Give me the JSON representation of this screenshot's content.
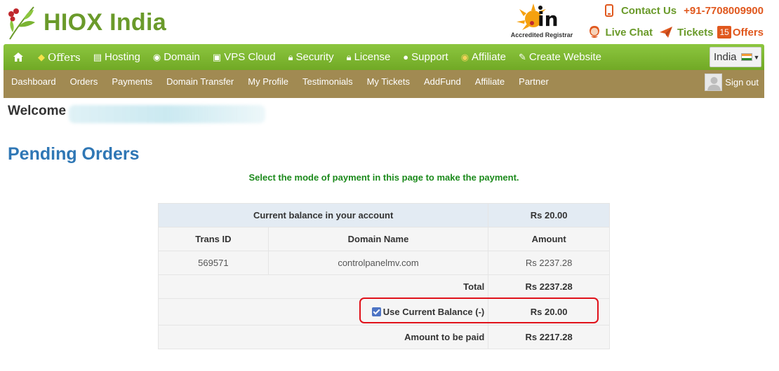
{
  "brand": {
    "name": "HIOX India"
  },
  "registrar": {
    "mark": ".in",
    "label": "Accredited Registrar"
  },
  "contact": {
    "label": "Contact Us",
    "phone": "+91-7708009900"
  },
  "support": {
    "live_chat": "Live Chat",
    "tickets": "Tickets",
    "offers_count": "15",
    "offers": "Offers"
  },
  "main_nav": {
    "items": [
      {
        "label": "Offers",
        "icon": "tag-icon"
      },
      {
        "label": "Hosting",
        "icon": "server-icon"
      },
      {
        "label": "Domain",
        "icon": "globe-icon"
      },
      {
        "label": "VPS Cloud",
        "icon": "monitor-icon"
      },
      {
        "label": "Security",
        "icon": "lock-icon"
      },
      {
        "label": "License",
        "icon": "lock-icon"
      },
      {
        "label": "Support",
        "icon": "user-icon"
      },
      {
        "label": "Affiliate",
        "icon": "money-bag-icon"
      },
      {
        "label": "Create Website",
        "icon": "pencil-icon"
      }
    ],
    "country": "India"
  },
  "sub_nav": {
    "items": [
      "Dashboard",
      "Orders",
      "Payments",
      "Domain Transfer",
      "My Profile",
      "Testimonials",
      "My Tickets",
      "AddFund",
      "Affiliate",
      "Partner"
    ],
    "sign_out": "Sign out"
  },
  "welcome": "Welcome",
  "page_title": "Pending Orders",
  "instruction": "Select the mode of payment in this page to make the payment.",
  "table": {
    "balance_label": "Current balance in your account",
    "balance_value": "Rs 20.00",
    "headers": [
      "Trans ID",
      "Domain Name",
      "Amount"
    ],
    "rows": [
      {
        "trans_id": "569571",
        "domain": "controlpanelmv.com",
        "amount": "Rs 2237.28"
      }
    ],
    "total_label": "Total",
    "total_value": "Rs 2237.28",
    "use_balance_label": "Use Current Balance (-)",
    "use_balance_checked": true,
    "use_balance_value": "Rs 20.00",
    "to_pay_label": "Amount to be paid",
    "to_pay_value": "Rs 2217.28"
  },
  "colors": {
    "brand_green": "#6a9a2a",
    "nav_green": "#7cb82f",
    "subnav_brown": "#a18a52",
    "accent_orange": "#e0581e",
    "title_blue": "#2f77b5",
    "instruction_green": "#1c8a1c",
    "highlight_red": "#e0111a"
  }
}
